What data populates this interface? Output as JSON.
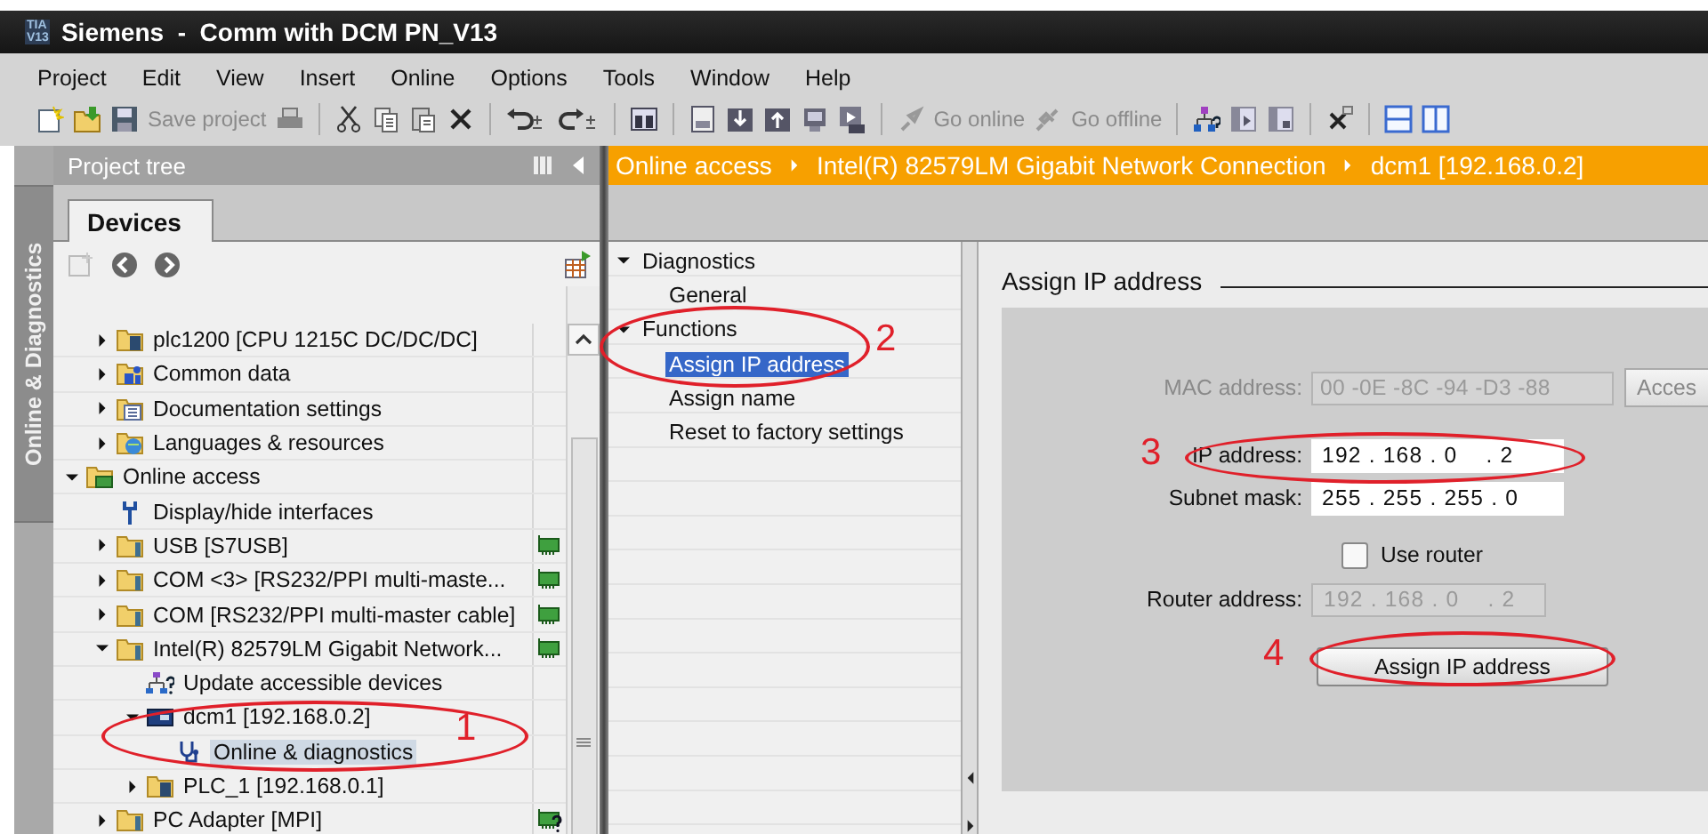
{
  "window": {
    "logo_top": "TIA",
    "logo_bottom": "V13",
    "title": "Siemens  -  Comm with DCM PN_V13"
  },
  "menu": [
    "Project",
    "Edit",
    "View",
    "Insert",
    "Online",
    "Options",
    "Tools",
    "Window",
    "Help"
  ],
  "toolbar": {
    "save": {
      "label": "Save project",
      "disabled": true
    },
    "go_online": {
      "label": "Go online",
      "disabled": true
    },
    "go_offline": {
      "label": "Go offline",
      "disabled": true
    }
  },
  "side_tab": {
    "label": "Online & Diagnostics",
    "selected": true
  },
  "project_tree": {
    "title": "Project tree",
    "tab": {
      "label": "Devices",
      "selected": true
    },
    "project_items": [
      {
        "label": "plc1200 [CPU 1215C DC/DC/DC]",
        "kind": "plc",
        "expanded": false,
        "selected": false
      },
      {
        "label": "Common data",
        "kind": "common-data",
        "expanded": false,
        "selected": false
      },
      {
        "label": "Documentation settings",
        "kind": "documentation",
        "expanded": false,
        "selected": false
      },
      {
        "label": "Languages & resources",
        "kind": "languages",
        "expanded": false,
        "selected": false
      }
    ],
    "online_access": {
      "label": "Online access",
      "kind": "online-access",
      "expanded": true,
      "selected": false,
      "children": [
        {
          "label": "Display/hide interfaces",
          "kind": "wrench",
          "selected": false
        },
        {
          "label": "USB [S7USB]",
          "kind": "interface",
          "expanded": false,
          "selected": false,
          "adapter": true,
          "adapter_unknown": false
        },
        {
          "label": "COM <3> [RS232/PPI multi-maste...",
          "kind": "interface",
          "expanded": false,
          "selected": false,
          "adapter": true,
          "adapter_unknown": false
        },
        {
          "label": "COM [RS232/PPI multi-master cable]",
          "kind": "interface",
          "expanded": false,
          "selected": false,
          "adapter": true,
          "adapter_unknown": false
        },
        {
          "label": "Intel(R) 82579LM Gigabit Network...",
          "kind": "interface",
          "expanded": true,
          "selected": false,
          "adapter": true,
          "adapter_unknown": false,
          "children": [
            {
              "label": "Update accessible devices",
              "kind": "accessible-devices",
              "selected": false
            },
            {
              "label": "dcm1 [192.168.0.2]",
              "kind": "device",
              "expanded": true,
              "selected": false,
              "children": [
                {
                  "label": "Online & diagnostics",
                  "kind": "diagnostics",
                  "selected": true
                }
              ]
            },
            {
              "label": "PLC_1 [192.168.0.1]",
              "kind": "plc",
              "expanded": false,
              "selected": false
            }
          ]
        },
        {
          "label": "PC Adapter [MPI]",
          "kind": "interface",
          "expanded": false,
          "selected": false,
          "adapter": true,
          "adapter_unknown": true
        }
      ]
    }
  },
  "breadcrumb": [
    "Online access",
    "Intel(R) 82579LM Gigabit Network Connection",
    "dcm1 [192.168.0.2]"
  ],
  "nav": [
    {
      "label": "Diagnostics",
      "expanded": true,
      "selected": false,
      "children": [
        {
          "label": "General",
          "selected": false
        }
      ]
    },
    {
      "label": "Functions",
      "expanded": true,
      "selected": false,
      "children": [
        {
          "label": "Assign IP address",
          "selected": true
        },
        {
          "label": "Assign name",
          "selected": false
        },
        {
          "label": "Reset to factory settings",
          "selected": false
        }
      ]
    }
  ],
  "assign_ip": {
    "heading": "Assign IP address",
    "mac_address": {
      "label": "MAC address:",
      "value": "00 -0E -8C -94 -D3 -88",
      "disabled": true
    },
    "access_button": "Acces",
    "ip_address": {
      "label": "IP address:",
      "value": "192 . 168 . 0    . 2",
      "disabled": false
    },
    "subnet_mask": {
      "label": "Subnet mask:",
      "value": "255 . 255 . 255 . 0",
      "disabled": false
    },
    "use_router": {
      "label": "Use router",
      "checked": false
    },
    "router_address": {
      "label": "Router address:",
      "value": "192 . 168 . 0    . 2",
      "disabled": true
    },
    "assign_button": "Assign IP address"
  },
  "annotations": [
    "1",
    "2",
    "3",
    "4"
  ]
}
